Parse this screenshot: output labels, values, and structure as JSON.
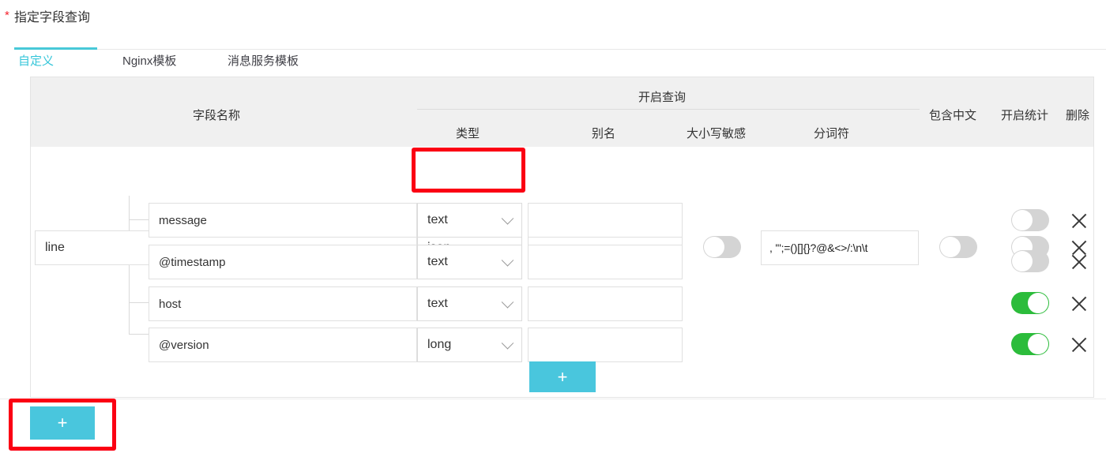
{
  "form": {
    "required_marker": "*",
    "label": "指定字段查询"
  },
  "tabs": {
    "items": [
      {
        "label": "自定义",
        "active": true
      },
      {
        "label": "Nginx模板",
        "active": false
      },
      {
        "label": "消息服务模板",
        "active": false
      }
    ]
  },
  "table": {
    "group_header": "开启查询",
    "columns": {
      "field_name": "字段名称",
      "type": "类型",
      "alias": "别名",
      "case_sensitive": "大小写敏感",
      "separator": "分词符",
      "contains_chinese": "包含中文",
      "enable_stats": "开启统计",
      "delete": "删除"
    },
    "rows": [
      {
        "field_name": "line",
        "type": "json",
        "alias": "",
        "case_sensitive": "off",
        "separator": ", '\";=()[]{}?@&<>/:\\n\\t",
        "contains_chinese": "off",
        "enable_stats": "off",
        "delete_icon": "close-icon",
        "nested": false
      },
      {
        "field_name": "message",
        "type": "text",
        "alias": "",
        "case_sensitive": "",
        "separator": "",
        "contains_chinese": "",
        "enable_stats": "off",
        "delete_icon": "close-icon",
        "nested": true
      },
      {
        "field_name": "@timestamp",
        "type": "text",
        "alias": "",
        "case_sensitive": "",
        "separator": "",
        "contains_chinese": "",
        "enable_stats": "off",
        "delete_icon": "close-icon",
        "nested": true
      },
      {
        "field_name": "host",
        "type": "text",
        "alias": "",
        "case_sensitive": "",
        "separator": "",
        "contains_chinese": "",
        "enable_stats": "on",
        "delete_icon": "close-icon",
        "nested": true
      },
      {
        "field_name": "@version",
        "type": "long",
        "alias": "",
        "case_sensitive": "",
        "separator": "",
        "contains_chinese": "",
        "enable_stats": "on",
        "delete_icon": "close-icon",
        "nested": true
      }
    ]
  },
  "buttons": {
    "add_nested_field": "+",
    "add_field": "+"
  },
  "colors": {
    "accent": "#49c6dd",
    "tab_active": "#36c6d9",
    "toggle_on": "#2cbc3b",
    "toggle_off": "#d4d4d4",
    "highlight_box": "#fb0013",
    "required_star": "#f5222d",
    "header_bg": "#f0f0f0"
  }
}
